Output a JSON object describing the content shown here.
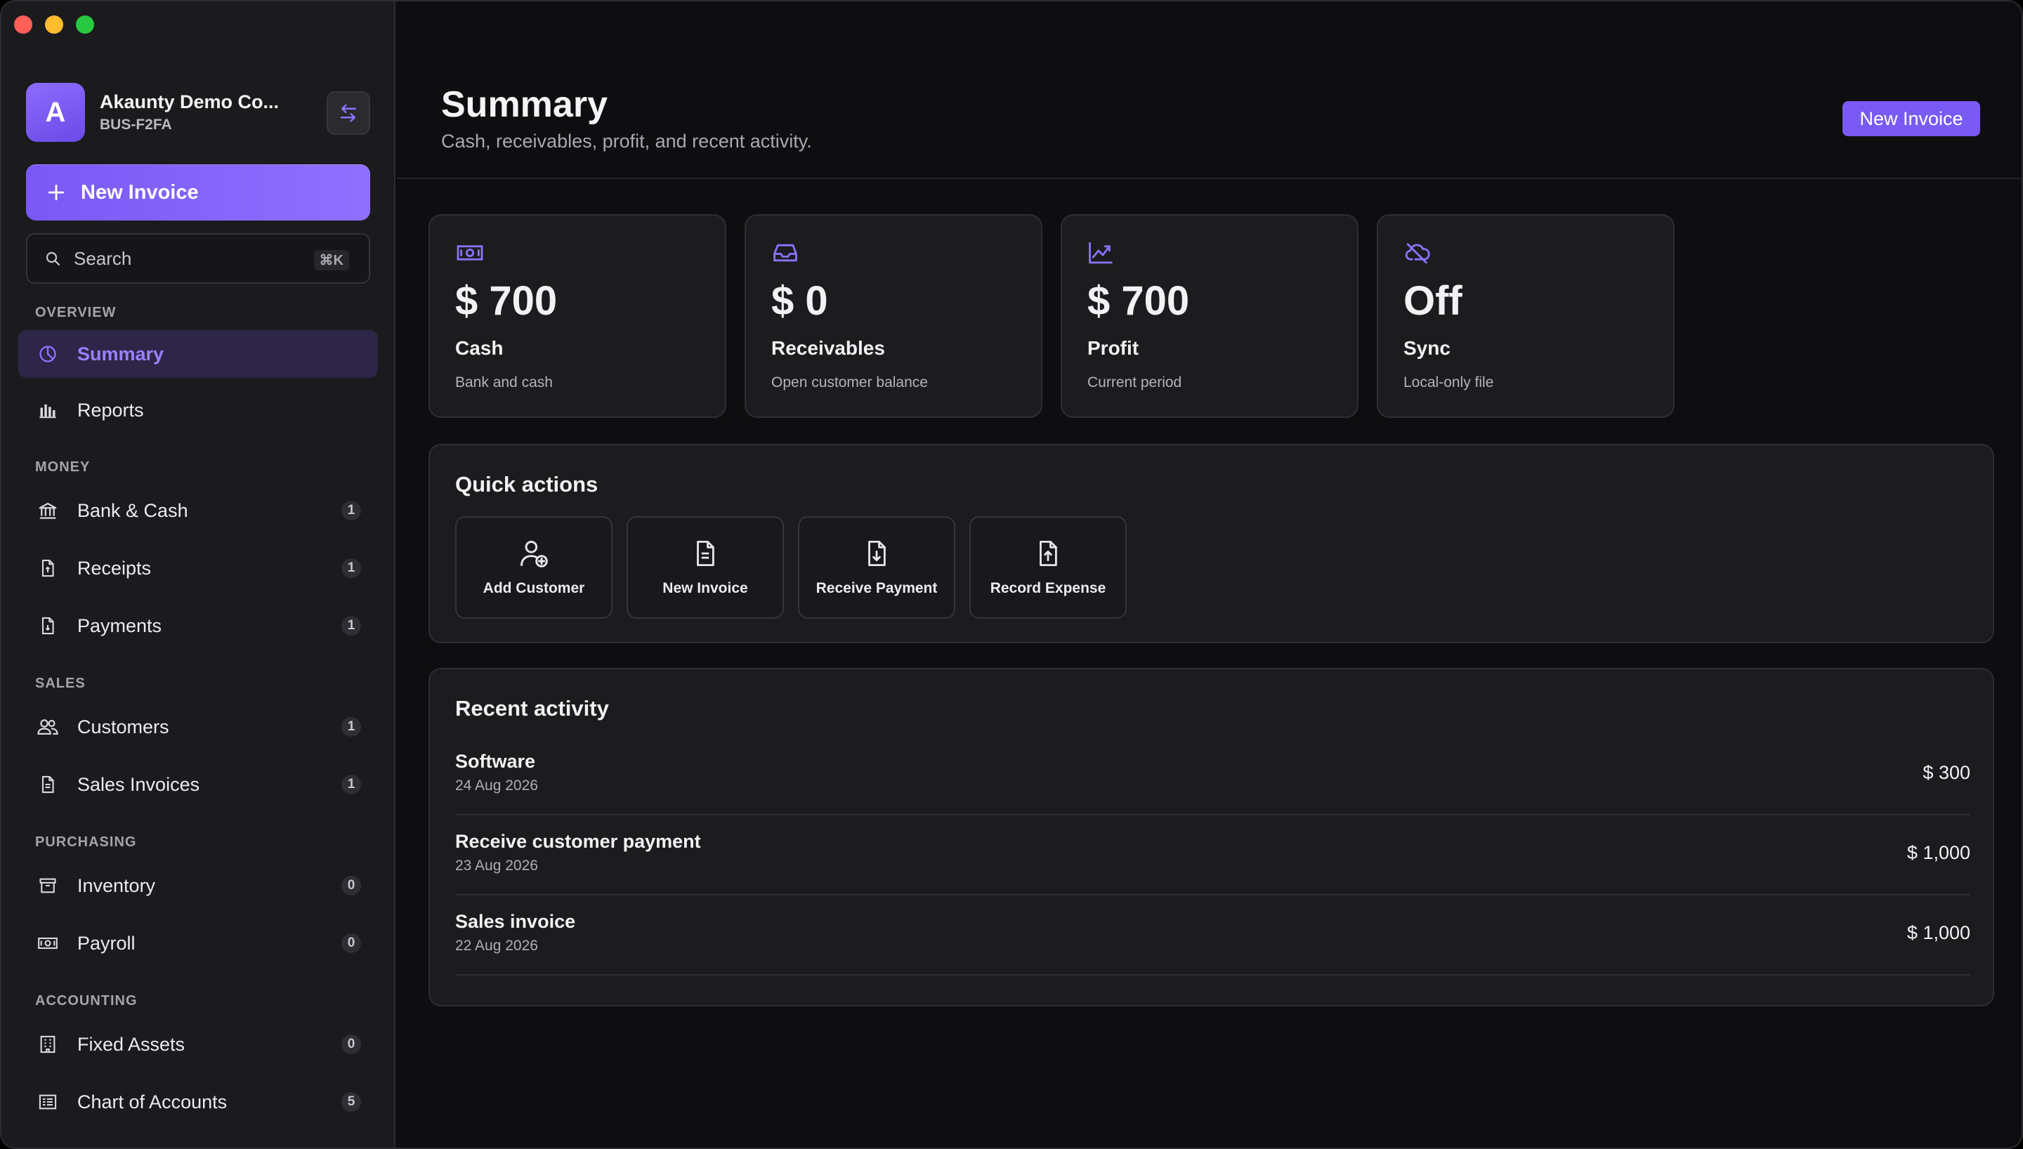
{
  "window": {
    "traffic_lights": [
      "close",
      "minimize",
      "zoom"
    ]
  },
  "sidebar": {
    "company": {
      "initial": "A",
      "name": "Akaunty Demo Co...",
      "code": "BUS-F2FA"
    },
    "new_invoice_label": "New Invoice",
    "search": {
      "placeholder": "Search",
      "shortcut": "⌘K"
    },
    "sections": [
      {
        "label": "OVERVIEW",
        "items": [
          {
            "label": "Summary",
            "icon": "pie-chart-icon",
            "active": true
          },
          {
            "label": "Reports",
            "icon": "bar-chart-icon"
          }
        ]
      },
      {
        "label": "MONEY",
        "items": [
          {
            "label": "Bank & Cash",
            "icon": "bank-icon",
            "count": "1"
          },
          {
            "label": "Receipts",
            "icon": "receipt-icon",
            "count": "1"
          },
          {
            "label": "Payments",
            "icon": "payment-icon",
            "count": "1"
          }
        ]
      },
      {
        "label": "SALES",
        "items": [
          {
            "label": "Customers",
            "icon": "users-icon",
            "count": "1"
          },
          {
            "label": "Sales Invoices",
            "icon": "document-icon",
            "count": "1"
          }
        ]
      },
      {
        "label": "PURCHASING",
        "items": [
          {
            "label": "Inventory",
            "icon": "archive-box-icon",
            "count": "0"
          },
          {
            "label": "Payroll",
            "icon": "banknote-icon",
            "count": "0"
          }
        ]
      },
      {
        "label": "ACCOUNTING",
        "items": [
          {
            "label": "Fixed Assets",
            "icon": "building-icon",
            "count": "0"
          },
          {
            "label": "Chart of Accounts",
            "icon": "ledger-icon",
            "count": "5"
          }
        ]
      }
    ]
  },
  "header": {
    "title": "Summary",
    "subtitle": "Cash, receivables, profit, and recent activity.",
    "new_invoice_label": "New Invoice"
  },
  "cards": [
    {
      "value": "$ 700",
      "label": "Cash",
      "sub": "Bank and cash",
      "icon": "banknote-icon"
    },
    {
      "value": "$ 0",
      "label": "Receivables",
      "sub": "Open customer balance",
      "icon": "inbox-icon"
    },
    {
      "value": "$ 700",
      "label": "Profit",
      "sub": "Current period",
      "icon": "trend-up-icon"
    },
    {
      "value": "Off",
      "label": "Sync",
      "sub": "Local-only file",
      "icon": "cloud-off-icon"
    }
  ],
  "quick_actions": {
    "title": "Quick actions",
    "items": [
      {
        "label": "Add Customer",
        "icon": "user-plus-icon"
      },
      {
        "label": "New Invoice",
        "icon": "document-icon"
      },
      {
        "label": "Receive Payment",
        "icon": "document-download-icon"
      },
      {
        "label": "Record Expense",
        "icon": "document-upload-icon"
      }
    ]
  },
  "recent_activity": {
    "title": "Recent activity",
    "items": [
      {
        "title": "Software",
        "date": "24 Aug 2026",
        "amount": "$ 300"
      },
      {
        "title": "Receive customer payment",
        "date": "23 Aug 2026",
        "amount": "$ 1,000"
      },
      {
        "title": "Sales invoice",
        "date": "22 Aug 2026",
        "amount": "$ 1,000"
      }
    ]
  },
  "colors": {
    "accent": "#7a5af5",
    "active_bg": "#2e2648",
    "card_bg": "#1c1c1f",
    "sidebar_bg": "#1b1b1e"
  }
}
